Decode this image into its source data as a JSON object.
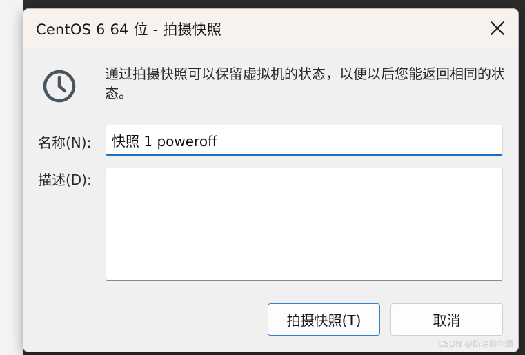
{
  "window": {
    "title": "CentOS 6 64 位 - 拍摄快照"
  },
  "info": {
    "icon": "clock-icon",
    "message": "通过拍摄快照可以保留虚拟机的状态，以便以后您能返回相同的状态。"
  },
  "form": {
    "name_label": "名称(N):",
    "name_value": "快照 1 poweroff",
    "description_label": "描述(D):",
    "description_value": ""
  },
  "buttons": {
    "take_snapshot": "拍摄快照(T)",
    "cancel": "取消"
  },
  "watermark": "CSDN @奶油蔚包蕾",
  "colors": {
    "accent": "#1a6fc4",
    "title_bar": "#f8f2ee",
    "dialog_bg": "#f0f0f0",
    "icon": "#4a5560"
  }
}
